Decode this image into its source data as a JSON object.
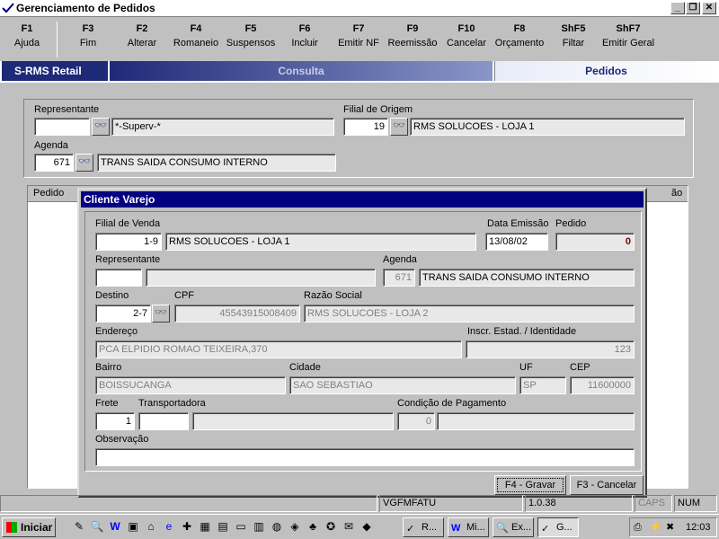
{
  "window": {
    "title": "Gerenciamento de Pedidos",
    "min": "_",
    "restore": "❐",
    "close": "✕"
  },
  "fkeys": [
    {
      "key": "F1",
      "label": "Ajuda"
    },
    {
      "key": "F3",
      "label": "Fim"
    },
    {
      "key": "F2",
      "label": "Alterar"
    },
    {
      "key": "F4",
      "label": "Romaneio"
    },
    {
      "key": "F5",
      "label": "Suspensos"
    },
    {
      "key": "F6",
      "label": "Incluir"
    },
    {
      "key": "F7",
      "label": "Emitir NF"
    },
    {
      "key": "F9",
      "label": "Reemissão"
    },
    {
      "key": "F10",
      "label": "Cancelar"
    },
    {
      "key": "F8",
      "label": "Orçamento"
    },
    {
      "key": "ShF5",
      "label": "Filtar"
    },
    {
      "key": "ShF7",
      "label": "Emitir Geral"
    }
  ],
  "banner": {
    "app": "S-RMS Retail",
    "mode": "Consulta",
    "screen": "Pedidos"
  },
  "top": {
    "representante_label": "Representante",
    "representante_code": "",
    "representante_name": "*-Superv-*",
    "filial_label": "Filial de Origem",
    "filial_code": "19",
    "filial_name": "RMS SOLUCOES - LOJA 1",
    "agenda_label": "Agenda",
    "agenda_code": "671",
    "agenda_name": "TRANS SAIDA CONSUMO INTERNO"
  },
  "grid": {
    "col1": "Pedido",
    "col_end": "ão"
  },
  "dialog": {
    "title": "Cliente Varejo",
    "filial_venda_label": "Filial de Venda",
    "filial_venda_code": "1-9",
    "filial_venda_name": "RMS SOLUCOES - LOJA 1",
    "data_emissao_label": "Data Emissão",
    "data_emissao": "13/08/02",
    "pedido_label": "Pedido",
    "pedido": "0",
    "representante_label": "Representante",
    "representante_code": "",
    "representante_name": "",
    "agenda_label": "Agenda",
    "agenda_code": "671",
    "agenda_name": "TRANS SAIDA CONSUMO INTERNO",
    "destino_label": "Destino",
    "destino": "2-7",
    "cpf_label": "CPF",
    "cpf": "45543915008409",
    "razao_label": "Razão Social",
    "razao": "RMS SOLUCOES - LOJA 2",
    "endereco_label": "Endereço",
    "endereco": "PCA ELPIDIO ROMAO TEIXEIRA,370",
    "inscr_label": "Inscr. Estad. / Identidade",
    "inscr": "123",
    "bairro_label": "Bairro",
    "bairro": "BOISSUCANGA",
    "cidade_label": "Cidade",
    "cidade": "SAO SEBASTIAO",
    "uf_label": "UF",
    "uf": "SP",
    "cep_label": "CEP",
    "cep": "11600000",
    "frete_label": "Frete",
    "frete": "1",
    "transp_label": "Transportadora",
    "transp_code": "",
    "transp_name": "",
    "cond_label": "Condição de Pagamento",
    "cond_code": "0",
    "cond_name": "",
    "obs_label": "Observação",
    "obs": "",
    "gravar": "F4 - Gravar",
    "cancelar": "F3 - Cancelar"
  },
  "status": {
    "prog": "VGFMFATU",
    "version": "1.0.38",
    "caps": "CAPS",
    "num": "NUM"
  },
  "taskbar": {
    "start": "Iniciar",
    "tasks": [
      "R...",
      "Mi...",
      "Ex...",
      "G..."
    ],
    "clock": "12:03"
  },
  "colors": {
    "title_bar": "#000080",
    "banner_dark": "#1e2a78",
    "pedido_value": "#800000"
  }
}
